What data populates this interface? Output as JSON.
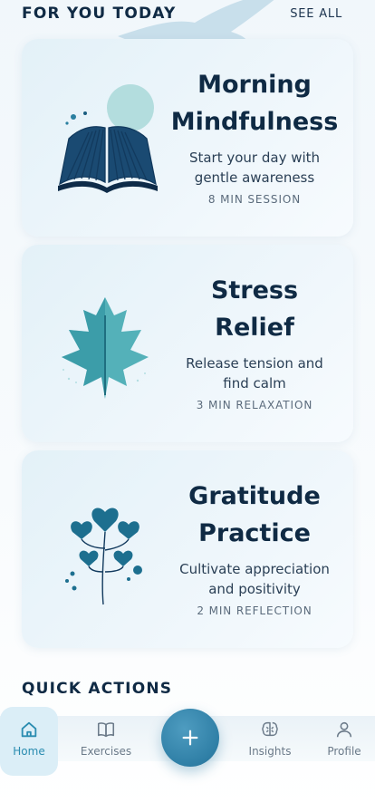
{
  "section": {
    "title": "FOR YOU TODAY",
    "see_all": "SEE ALL"
  },
  "cards": [
    {
      "title_line1": "Morning",
      "title_line2": "Mindfulness",
      "subtitle_line1": "Start your day with",
      "subtitle_line2": "gentle awareness",
      "meta": "8 MIN SESSION",
      "icon": "open-book-icon"
    },
    {
      "title_line1": "Stress",
      "title_line2": "Relief",
      "subtitle_line1": "Release tension and",
      "subtitle_line2": "find calm",
      "meta": "3 MIN RELAXATION",
      "icon": "maple-leaf-icon"
    },
    {
      "title_line1": "Gratitude",
      "title_line2": "Practice",
      "subtitle_line1": "Cultivate appreciation",
      "subtitle_line2": "and positivity",
      "meta": "2 MIN REFLECTION",
      "icon": "heart-flower-icon"
    }
  ],
  "quick_actions": {
    "title": "QUICK ACTIONS"
  },
  "tabbar": {
    "items": [
      {
        "label": "Home",
        "icon": "home-icon",
        "active": true
      },
      {
        "label": "Exercises",
        "icon": "book-icon",
        "active": false
      },
      {
        "label": "Insights",
        "icon": "brain-icon",
        "active": false
      },
      {
        "label": "Profile",
        "icon": "user-icon",
        "active": false
      }
    ],
    "fab_icon": "plus-icon"
  },
  "colors": {
    "accent": "#2f7fa6",
    "title": "#0f2a44",
    "active_tab": "#2a8cb0"
  }
}
